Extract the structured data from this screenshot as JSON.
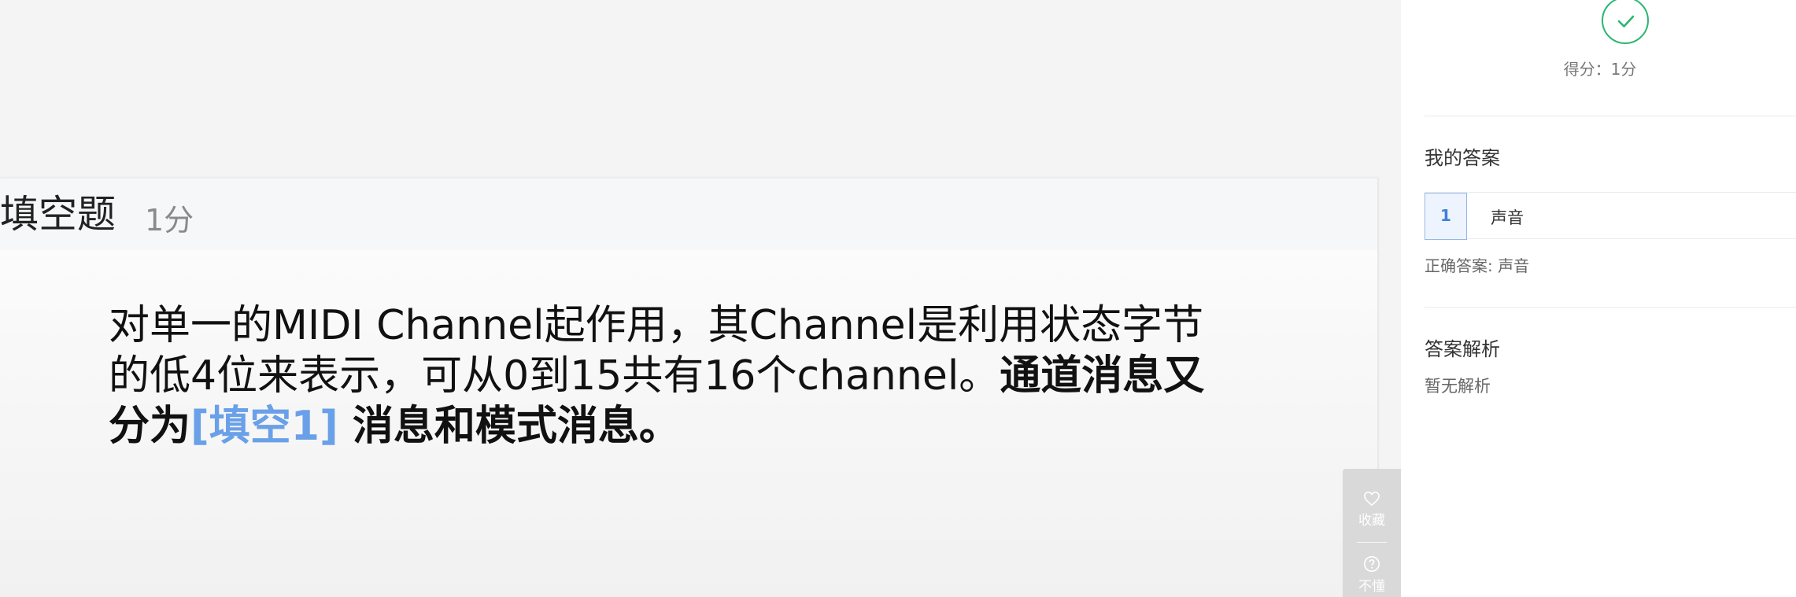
{
  "question": {
    "type_label": "填空题",
    "score_label": "1分",
    "stem_plain": "对单一的MIDI Channel起作用，其Channel是利用状态字节的低4位来表示，可从0到15共有16个channel。",
    "stem_bold_1": "通道消息又分为",
    "blank_label": "[填空1]",
    "stem_bold_2": " 消息和模式消息。"
  },
  "tools": {
    "favorite_label": "收藏",
    "favorite_icon": "heart-icon",
    "not_understand_label": "不懂",
    "not_understand_icon": "question-circle-icon"
  },
  "result": {
    "status_icon": "check-icon",
    "status_color": "#2bb673",
    "score_text": "得分：1分"
  },
  "my_answer": {
    "title": "我的答案",
    "index": "1",
    "value": "声音",
    "correct_text": "正确答案: 声音"
  },
  "analysis": {
    "title": "答案解析",
    "content": "暂无解析"
  },
  "colors": {
    "blank": "#6aa0e8",
    "index_border": "#94b8ea",
    "tool_bg": "#d9d9d9"
  }
}
